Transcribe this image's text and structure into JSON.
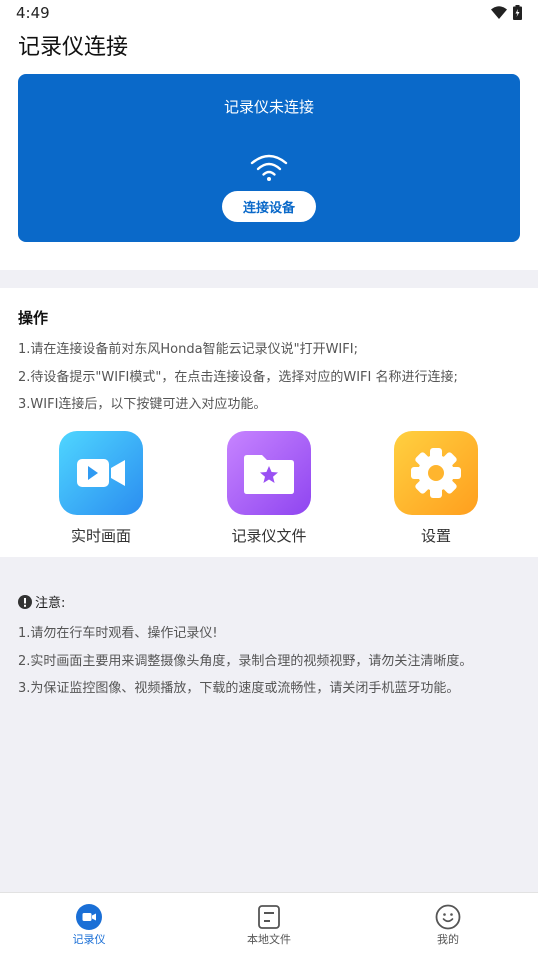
{
  "status_bar": {
    "time": "4:49"
  },
  "page": {
    "title": "记录仪连接"
  },
  "connect_card": {
    "status_text": "记录仪未连接",
    "button_label": "连接设备",
    "background_color": "#0a69c9"
  },
  "operations": {
    "title": "操作",
    "lines": [
      "1.请在连接设备前对东风Honda智能云记录仪说\"打开WIFI;",
      "2.待设备提示\"WIFI模式\"，在点击连接设备，选择对应的WIFI 名称进行连接;",
      "3.WIFI连接后，以下按键可进入对应功能。"
    ]
  },
  "functions": [
    {
      "label": "实时画面",
      "icon": "video-camera-icon"
    },
    {
      "label": "记录仪文件",
      "icon": "star-folder-icon"
    },
    {
      "label": "设置",
      "icon": "gear-icon"
    }
  ],
  "notes": {
    "title": "注意:",
    "lines": [
      "1.请勿在行车时观看、操作记录仪!",
      "2.实时画面主要用来调整摄像头角度，录制合理的视频视野，请勿关注清晰度。",
      "3.为保证监控图像、视频播放，下载的速度或流畅性，请关闭手机蓝牙功能。"
    ]
  },
  "bottom_nav": {
    "active": "记录仪",
    "items": [
      {
        "label": "记录仪",
        "icon": "recorder-icon"
      },
      {
        "label": "本地文件",
        "icon": "file-icon"
      },
      {
        "label": "我的",
        "icon": "smile-icon"
      }
    ]
  },
  "colors": {
    "accent": "#1a6fd6",
    "background_gray": "#f0f0f5"
  }
}
